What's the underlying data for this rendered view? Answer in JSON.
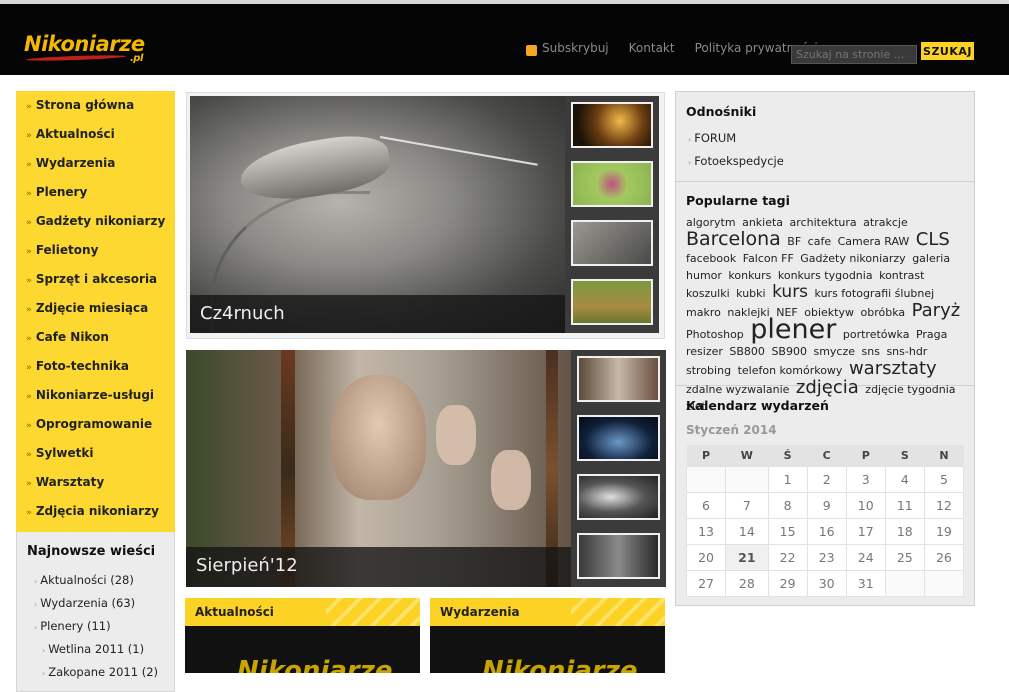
{
  "site": {
    "logo_main": "Nikoniarze",
    "logo_suffix": ".pl"
  },
  "topnav": {
    "subscribe": "Subskrybuj",
    "contact": "Kontakt",
    "privacy": "Polityka prywatności"
  },
  "search": {
    "placeholder": "Szukaj na stronie ...",
    "button": "SZUKAJ"
  },
  "menu": [
    "Strona główna",
    "Aktualności",
    "Wydarzenia",
    "Plenery",
    "Gadżety nikoniarzy",
    "Felietony",
    "Sprzęt i akcesoria",
    "Zdjęcie miesiąca",
    "Cafe Nikon",
    "Foto-technika",
    "Nikoniarze-usługi",
    "Oprogramowanie",
    "Sylwetki",
    "Warsztaty",
    "Zdjęcia nikoniarzy"
  ],
  "news": {
    "title": "Najnowsze wieści",
    "items": [
      "Aktualności (28)",
      "Wydarzenia (63)",
      "Plenery (11)",
      "Wetlina 2011 (1)",
      "Zakopane 2011 (2)"
    ]
  },
  "sliders": [
    {
      "caption": "Cz4rnuch"
    },
    {
      "caption": "Sierpień'12"
    }
  ],
  "boxes": {
    "news_title": "Aktualności",
    "events_title": "Wydarzenia",
    "logo_text": "Nikoniarze"
  },
  "links": {
    "title": "Odnośniki",
    "items": [
      "FORUM",
      "Fotoekspedycje"
    ]
  },
  "tags": {
    "title": "Popularne tagi",
    "list": [
      {
        "t": "algorytm",
        "s": 11
      },
      {
        "t": "ankieta",
        "s": 11
      },
      {
        "t": "architektura",
        "s": 11
      },
      {
        "t": "atrakcje",
        "s": 11
      },
      {
        "t": "Barcelona",
        "s": 19
      },
      {
        "t": "BF",
        "s": 11
      },
      {
        "t": "cafe",
        "s": 11
      },
      {
        "t": "Camera RAW",
        "s": 11
      },
      {
        "t": "CLS",
        "s": 18
      },
      {
        "t": "facebook",
        "s": 11
      },
      {
        "t": "Falcon FF",
        "s": 11
      },
      {
        "t": "Gadżety nikoniarzy",
        "s": 11
      },
      {
        "t": "galeria",
        "s": 11
      },
      {
        "t": "humor",
        "s": 11
      },
      {
        "t": "konkurs",
        "s": 11
      },
      {
        "t": "konkurs tygodnia",
        "s": 11
      },
      {
        "t": "kontrast",
        "s": 11
      },
      {
        "t": "koszulki",
        "s": 11
      },
      {
        "t": "kubki",
        "s": 11
      },
      {
        "t": "kurs",
        "s": 17
      },
      {
        "t": "kurs fotografii ślubnej",
        "s": 11
      },
      {
        "t": "makro",
        "s": 11
      },
      {
        "t": "naklejki",
        "s": 11
      },
      {
        "t": "NEF",
        "s": 11
      },
      {
        "t": "obiektyw",
        "s": 11
      },
      {
        "t": "obróbka",
        "s": 11
      },
      {
        "t": "Paryż",
        "s": 18
      },
      {
        "t": "Photoshop",
        "s": 11
      },
      {
        "t": "plener",
        "s": 27
      },
      {
        "t": "portretówka",
        "s": 11
      },
      {
        "t": "Praga",
        "s": 11
      },
      {
        "t": "resizer",
        "s": 11
      },
      {
        "t": "SB800",
        "s": 11
      },
      {
        "t": "SB900",
        "s": 11
      },
      {
        "t": "smycze",
        "s": 11
      },
      {
        "t": "sns",
        "s": 11
      },
      {
        "t": "sns-hdr",
        "s": 11
      },
      {
        "t": "strobing",
        "s": 11
      },
      {
        "t": "telefon komórkowy",
        "s": 11
      },
      {
        "t": "warsztaty",
        "s": 18
      },
      {
        "t": "zdalne wyzwalanie",
        "s": 11
      },
      {
        "t": "zdjęcia",
        "s": 18
      },
      {
        "t": "zdjęcie tygodnia",
        "s": 11
      },
      {
        "t": "zlot",
        "s": 11
      }
    ]
  },
  "calendar": {
    "title": "Kalendarz wydarzeń",
    "month": "Styczeń 2014",
    "days": [
      "P",
      "W",
      "Ś",
      "C",
      "P",
      "S",
      "N"
    ],
    "weeks": [
      [
        "",
        "",
        "1",
        "2",
        "3",
        "4",
        "5"
      ],
      [
        "6",
        "7",
        "8",
        "9",
        "10",
        "11",
        "12"
      ],
      [
        "13",
        "14",
        "15",
        "16",
        "17",
        "18",
        "19"
      ],
      [
        "20",
        "21",
        "22",
        "23",
        "24",
        "25",
        "26"
      ],
      [
        "27",
        "28",
        "29",
        "30",
        "31",
        "",
        ""
      ]
    ],
    "today": "21"
  },
  "colors": {
    "accent": "#fcd224",
    "header": "#050505",
    "logo": "#f5b800"
  }
}
